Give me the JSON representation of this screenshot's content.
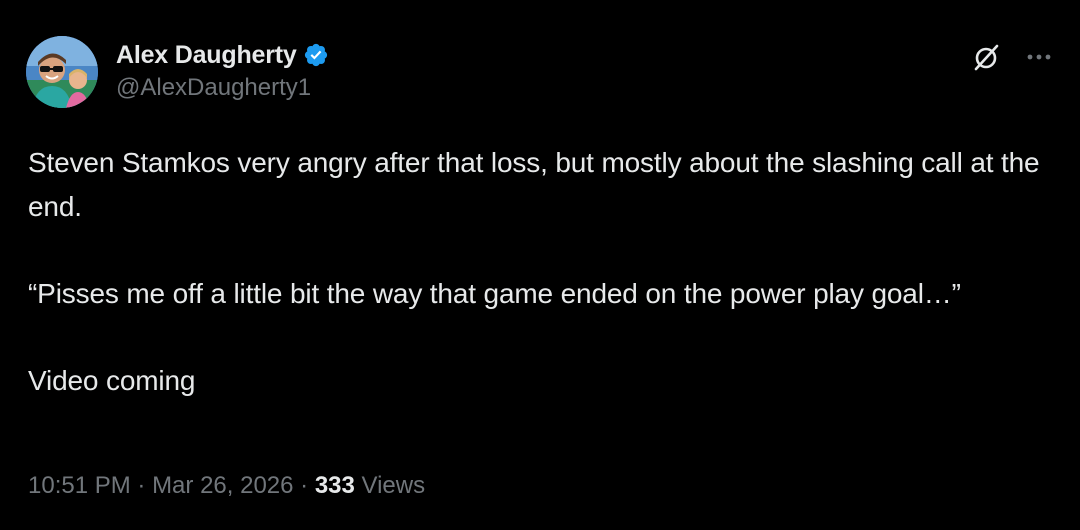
{
  "author": {
    "display_name": "Alex Daugherty",
    "handle": "@AlexDaugherty1",
    "verified": true,
    "verified_color": "#1d9bf0",
    "avatar_icon": "profile-photo"
  },
  "actions": {
    "grok_icon": "grok-icon",
    "more_icon": "more-icon"
  },
  "tweet": {
    "paragraphs": [
      "Steven Stamkos very angry after that loss, but mostly about the slashing call at the end.",
      "“Pisses me off a little bit the way that game ended on the power play goal…”",
      "Video coming"
    ]
  },
  "meta": {
    "time": "10:51 PM",
    "separator": " · ",
    "date": "Mar 26, 2026",
    "views_count": "333",
    "views_label": " Views"
  },
  "colors": {
    "background": "#000000",
    "text_primary": "#e7e9ea",
    "text_secondary": "#71767b"
  }
}
